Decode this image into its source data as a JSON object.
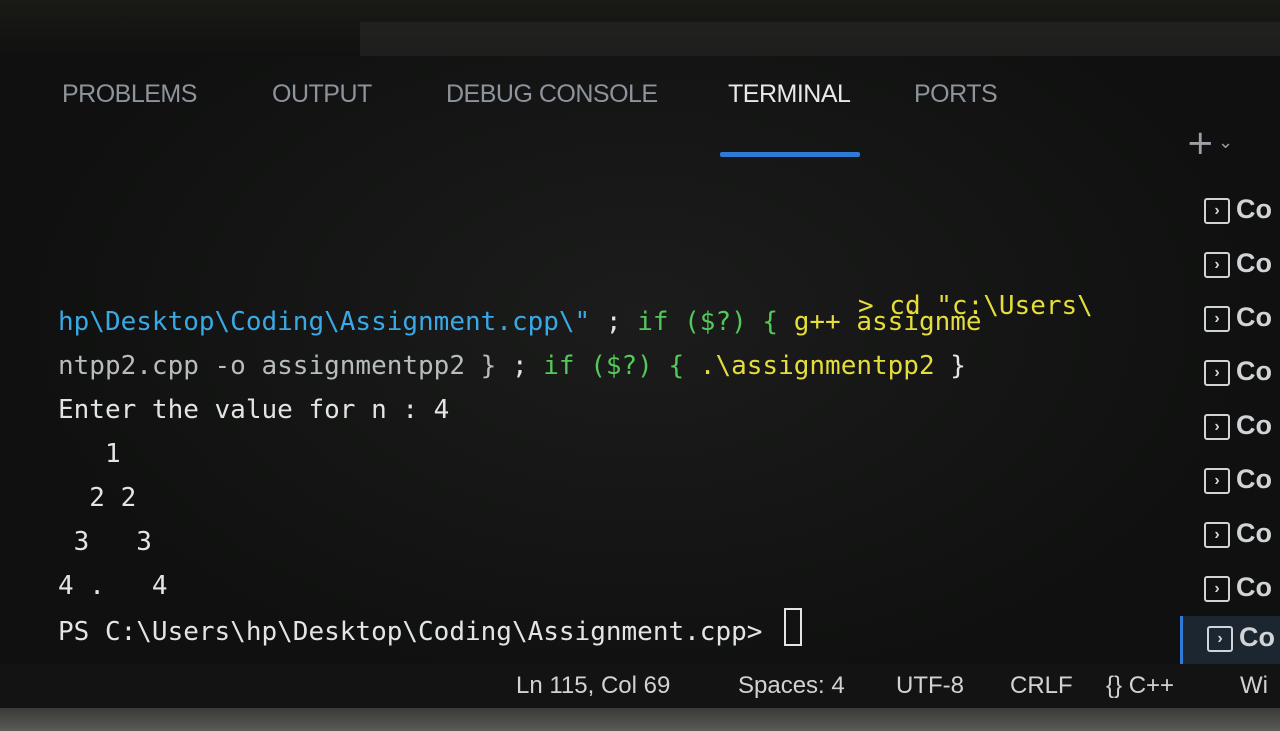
{
  "tabs": [
    {
      "label": "PROBLEMS"
    },
    {
      "label": "OUTPUT"
    },
    {
      "label": "DEBUG CONSOLE"
    },
    {
      "label": "TERMINAL"
    },
    {
      "label": "PORTS"
    }
  ],
  "active_tab": "TERMINAL",
  "panel_actions": {
    "new_terminal_icon": "plus-icon",
    "new_terminal_label": "+",
    "dropdown_label": "⌄"
  },
  "terminal": {
    "cmd_prefix": "> ",
    "cmd_cd": "cd \"c:\\Users\\",
    "cmd_path": "hp\\Desktop\\Coding\\Assignment.cpp\\\"",
    "sep1": " ; ",
    "if1": "if ($?) {",
    "compile": " g++ assignme",
    "compile_cont": "ntpp2.cpp -o assignmentpp2 }",
    "sep2": " ; ",
    "if2": "if ($?) {",
    "run": " .\\assignmentpp2",
    "close": " }",
    "output_lines": [
      "Enter the value for n : 4",
      "   1",
      "  2 2",
      " 3   3",
      "4 .   4"
    ],
    "prompt": "PS C:\\Users\\hp\\Desktop\\Coding\\Assignment.cpp> "
  },
  "terminal_list": [
    {
      "label": "Co"
    },
    {
      "label": "Co"
    },
    {
      "label": "Co"
    },
    {
      "label": "Co"
    },
    {
      "label": "Co"
    },
    {
      "label": "Co"
    },
    {
      "label": "Co"
    },
    {
      "label": "Co"
    },
    {
      "label": "Co"
    }
  ],
  "statusbar": {
    "position": "Ln 115, Col 69",
    "spaces": "Spaces: 4",
    "encoding": "UTF-8",
    "eol": "CRLF",
    "language": "{} C++",
    "extra": "Wi"
  },
  "colors": {
    "accent": "#2f7ad6",
    "path": "#39a9e6",
    "command": "#e4dd3b",
    "keyword": "#54c95a"
  }
}
